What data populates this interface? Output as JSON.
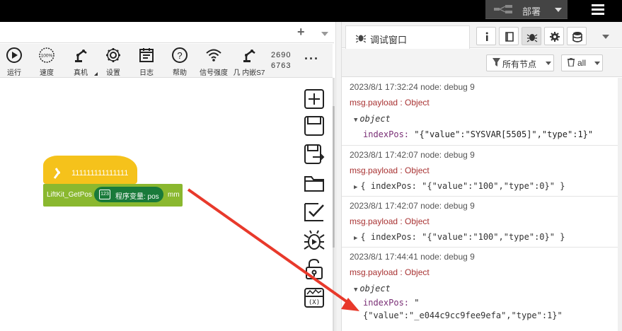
{
  "header": {
    "deploy_label": "部署"
  },
  "toolbar": {
    "items": [
      {
        "label": "运行",
        "icon": "play-icon"
      },
      {
        "label": "速度",
        "icon": "speed-gauge-icon",
        "gauge_text": "100%"
      },
      {
        "label": "真机",
        "icon": "robot-arm-icon"
      },
      {
        "label": "设置",
        "icon": "gear-icon"
      },
      {
        "label": "日志",
        "icon": "log-icon"
      },
      {
        "label": "帮助",
        "icon": "help-icon"
      },
      {
        "label": "信号强度",
        "icon": "wifi-icon"
      },
      {
        "label": "几 内嵌S7",
        "icon": "robot-arm-icon"
      }
    ],
    "num_line1": "2690",
    "num_line2": "6763",
    "more": "···"
  },
  "workspace": {
    "hat_block_text": "111111111111111",
    "command_block": {
      "name": "LiftKit_GetPos",
      "pill_icon_text": "123",
      "pill_text": "程序变量: pos",
      "unit": "mm"
    }
  },
  "debug_panel": {
    "tab_title": "调试窗口",
    "filter_nodes_label": "所有节点",
    "clear_label": "all",
    "messages": [
      {
        "meta": "2023/8/1 17:32:24   node: debug 9",
        "topic": "msg.payload : Object",
        "expanded": true,
        "object_label": "object",
        "key": "indexPos:",
        "value": "\"{\"value\":\"SYSVAR[5505]\",\"type\":1}\""
      },
      {
        "meta": "2023/8/1 17:42:07   node: debug 9",
        "topic": "msg.payload : Object",
        "expanded": false,
        "summary_open": "{ ",
        "key": "indexPos:",
        "value": "\"{\"value\":\"100\",\"type\":0}\"",
        "summary_close": " }"
      },
      {
        "meta": "2023/8/1 17:42:07   node: debug 9",
        "topic": "msg.payload : Object",
        "expanded": false,
        "summary_open": "{ ",
        "key": "indexPos:",
        "value": "\"{\"value\":\"100\",\"type\":0}\"",
        "summary_close": " }"
      },
      {
        "meta": "2023/8/1 17:44:41   node: debug 9",
        "topic": "msg.payload : Object",
        "expanded": true,
        "object_label": "object",
        "key": "indexPos:",
        "value_line1": "\"",
        "value_line2": "{\"value\":\"_e044c9cc9fee9efa\",\"type\":1}\""
      }
    ]
  },
  "colors": {
    "hat_block": "#f5c21b",
    "command_block": "#8ab82f",
    "pill": "#197a3a",
    "annotation_arrow": "#e8392b",
    "topic_text": "#a83232"
  }
}
